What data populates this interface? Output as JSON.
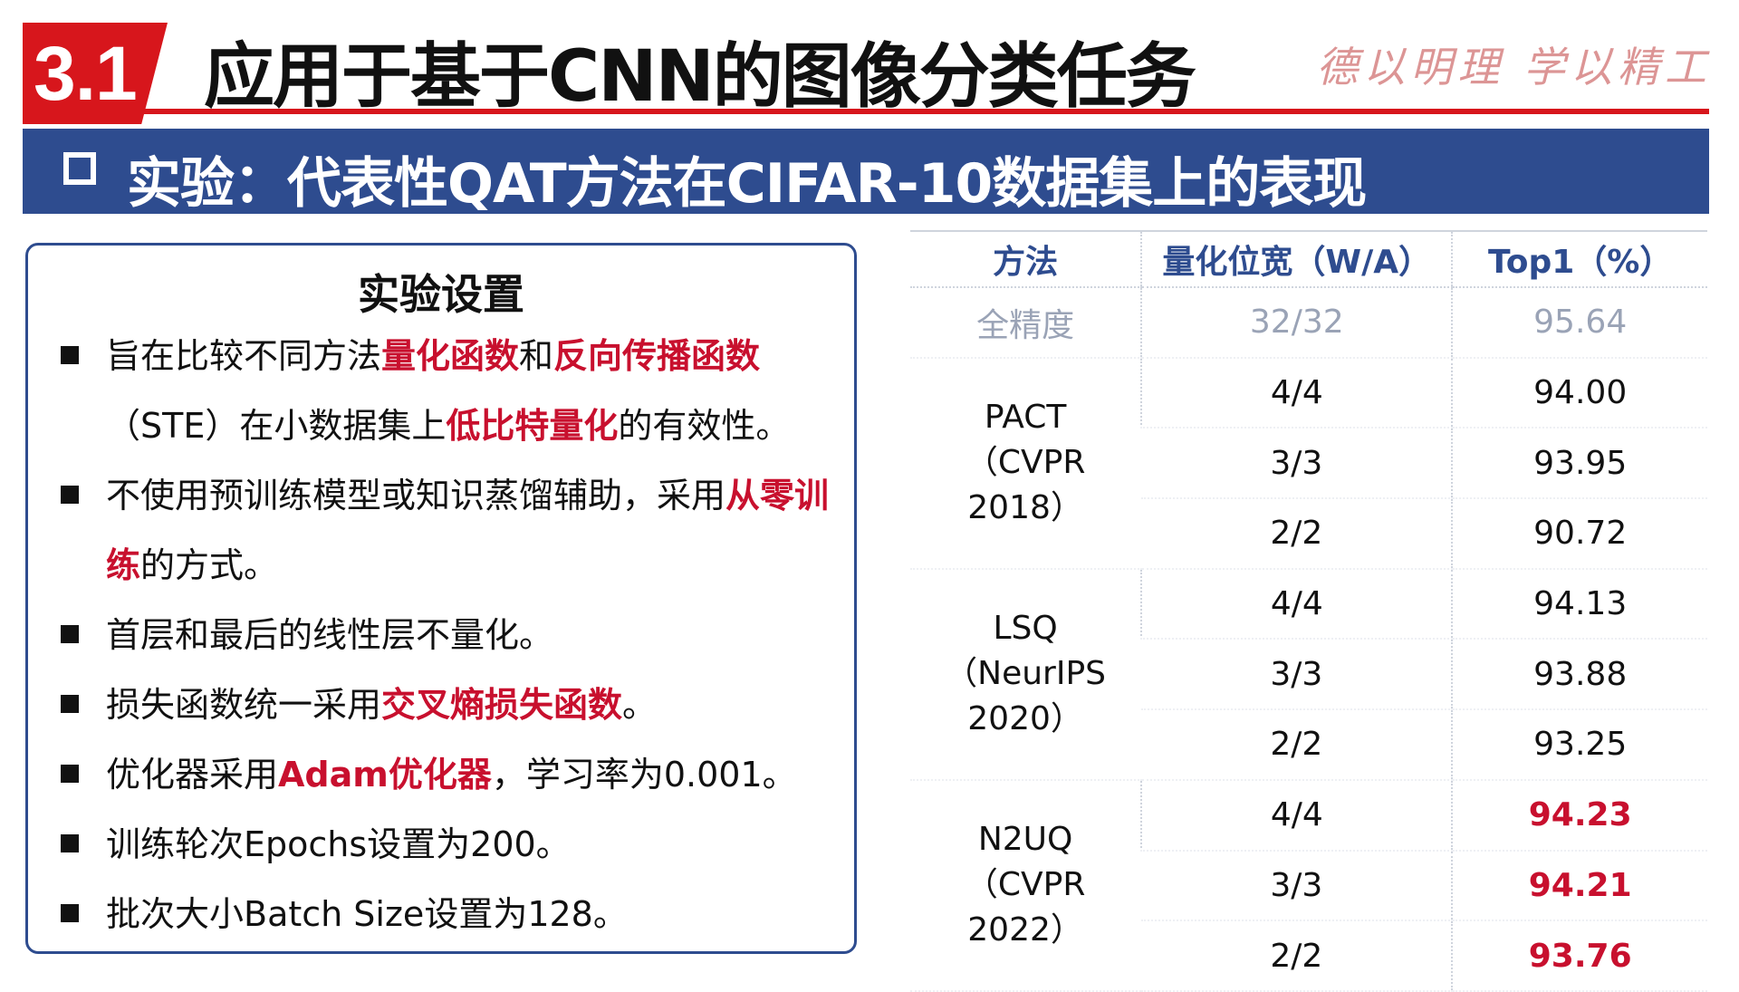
{
  "header": {
    "section_number": "3.1",
    "title": "应用于基于CNN的图像分类任务",
    "motto": "德以明理 学以精工"
  },
  "subtitle": "实验：代表性QAT方法在CIFAR-10数据集上的表现",
  "settings": {
    "title": "实验设置",
    "items": [
      {
        "parts": [
          {
            "t": "旨在比较不同方法"
          },
          {
            "t": "量化函数",
            "hl": true
          },
          {
            "t": "和"
          },
          {
            "t": "反向传播函数",
            "hl": true
          },
          {
            "t": "（STE）在小数据集上"
          },
          {
            "t": "低比特量化",
            "hl": true
          },
          {
            "t": "的有效性。"
          }
        ]
      },
      {
        "parts": [
          {
            "t": "不使用预训练模型或知识蒸馏辅助，采用"
          },
          {
            "t": "从零训练",
            "hl": true
          },
          {
            "t": "的方式。"
          }
        ]
      },
      {
        "parts": [
          {
            "t": "首层和最后的线性层不量化。"
          }
        ]
      },
      {
        "parts": [
          {
            "t": "损失函数统一采用"
          },
          {
            "t": "交叉熵损失函数",
            "hl": true
          },
          {
            "t": "。"
          }
        ]
      },
      {
        "parts": [
          {
            "t": "优化器采用"
          },
          {
            "t": "Adam优化器",
            "hl": true
          },
          {
            "t": "，学习率为0.001。"
          }
        ]
      },
      {
        "parts": [
          {
            "t": "训练轮次Epochs设置为200。"
          }
        ]
      },
      {
        "parts": [
          {
            "t": "批次大小Batch Size设置为128。"
          }
        ]
      }
    ]
  },
  "table": {
    "headers": [
      "方法",
      "量化位宽（W/A）",
      "Top1（%）"
    ],
    "full_precision": {
      "method": "全精度",
      "bits": "32/32",
      "top1": "95.64"
    },
    "groups": [
      {
        "name": "PACT",
        "venue": "（CVPR 2018）",
        "rows": [
          {
            "bits": "4/4",
            "top1": "94.00",
            "best": false
          },
          {
            "bits": "3/3",
            "top1": "93.95",
            "best": false
          },
          {
            "bits": "2/2",
            "top1": "90.72",
            "best": false
          }
        ]
      },
      {
        "name": "LSQ",
        "venue": "（NeurIPS 2020）",
        "rows": [
          {
            "bits": "4/4",
            "top1": "94.13",
            "best": false
          },
          {
            "bits": "3/3",
            "top1": "93.88",
            "best": false
          },
          {
            "bits": "2/2",
            "top1": "93.25",
            "best": false
          }
        ]
      },
      {
        "name": "N2UQ",
        "venue": "（CVPR 2022）",
        "rows": [
          {
            "bits": "4/4",
            "top1": "94.23",
            "best": true
          },
          {
            "bits": "3/3",
            "top1": "94.21",
            "best": true
          },
          {
            "bits": "2/2",
            "top1": "93.76",
            "best": true
          }
        ]
      }
    ]
  },
  "colors": {
    "accent_red": "#d7161c",
    "highlight_red": "#c8102e",
    "navy": "#2e4c8f"
  }
}
